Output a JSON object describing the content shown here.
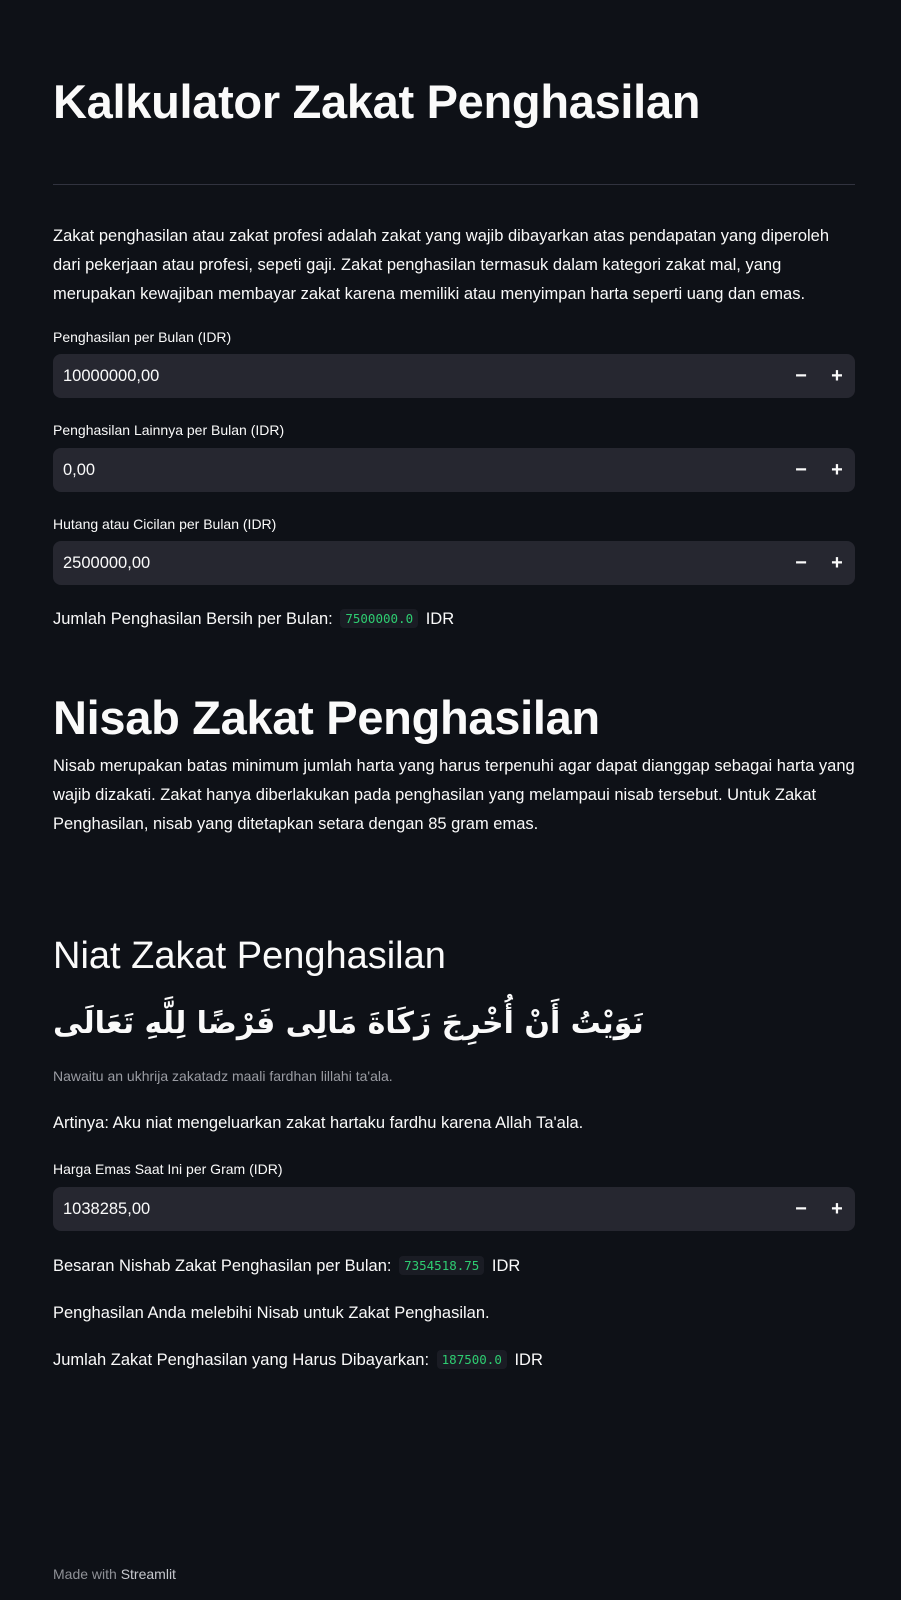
{
  "title": "Kalkulator Zakat Penghasilan",
  "intro": "Zakat penghasilan atau zakat profesi adalah zakat yang wajib dibayarkan atas pendapatan yang diperoleh dari pekerjaan atau profesi, sepeti gaji. Zakat penghasilan termasuk dalam kategori zakat mal, yang merupakan kewajiban membayar zakat karena memiliki atau menyimpan harta seperti uang dan emas.",
  "inputs": {
    "income": {
      "label": "Penghasilan per Bulan (IDR)",
      "value": "10000000,00"
    },
    "other_income": {
      "label": "Penghasilan Lainnya per Bulan (IDR)",
      "value": "0,00"
    },
    "debt": {
      "label": "Hutang atau Cicilan per Bulan (IDR)",
      "value": "2500000,00"
    },
    "gold_price": {
      "label": "Harga Emas Saat Ini per Gram (IDR)",
      "value": "1038285,00"
    }
  },
  "steppers": {
    "minus": "−",
    "plus": "+"
  },
  "net_income": {
    "label": "Jumlah Penghasilan Bersih per Bulan:",
    "value": "7500000.0",
    "unit": "IDR"
  },
  "nisab": {
    "heading": "Nisab Zakat Penghasilan",
    "text": "Nisab merupakan batas minimum jumlah harta yang harus terpenuhi agar dapat dianggap sebagai harta yang wajib dizakati. Zakat hanya diberlakukan pada penghasilan yang melampaui nisab tersebut. Untuk Zakat Penghasilan, nisab yang ditetapkan setara dengan 85 gram emas."
  },
  "niat": {
    "heading": "Niat Zakat Penghasilan",
    "arabic": "نَوَيْتُ أَنْ أُخْرِجَ زَكَاةَ مَالِى فَرْضًا لِلَّهِ تَعَالَى",
    "transliteration": "Nawaitu an ukhrija zakatadz maali fardhan lillahi ta'ala.",
    "meaning": "Artinya: Aku niat mengeluarkan zakat hartaku fardhu karena Allah Ta'ala."
  },
  "nishab_result": {
    "label": "Besaran Nishab Zakat Penghasilan per Bulan:",
    "value": "7354518.75",
    "unit": "IDR"
  },
  "status_text": "Penghasilan Anda melebihi Nisab untuk Zakat Penghasilan.",
  "zakat_result": {
    "label": "Jumlah Zakat Penghasilan yang Harus Dibayarkan:",
    "value": "187500.0",
    "unit": "IDR"
  },
  "footer": {
    "prefix": "Made with",
    "brand": "Streamlit"
  },
  "colors": {
    "background": "#0e1117",
    "input_bg": "#262730",
    "code_value": "#2ecc71"
  }
}
